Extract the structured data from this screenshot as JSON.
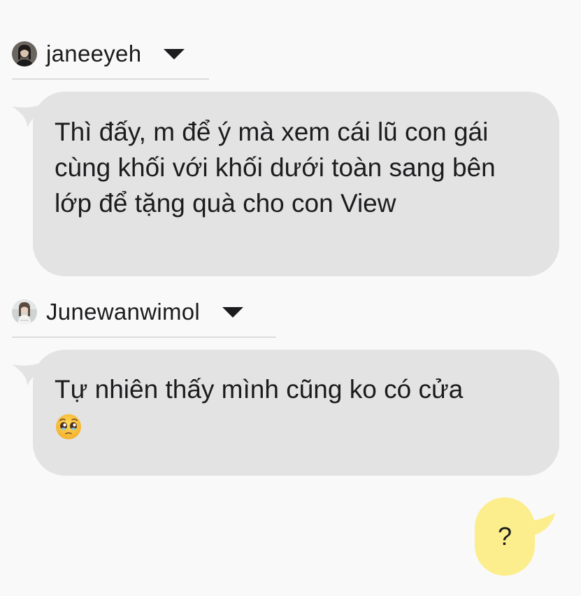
{
  "messages": [
    {
      "sender": "janeeyeh",
      "text": "Thì đấy, m để ý mà xem cái lũ con gái cùng khối với khối dưới toàn sang bên lớp để tặng quà cho con View"
    },
    {
      "sender": "Junewanwimol",
      "text": "Tự nhiên thấy mình cũng ko có cửa",
      "emoji": "pleading-face-emoji"
    }
  ],
  "my_message": {
    "text": "?"
  },
  "colors": {
    "background": "#f9f9f9",
    "incoming_bubble": "#e3e3e3",
    "outgoing_bubble": "#fcee8c",
    "divider": "#dcdcdc"
  },
  "icons": {
    "dropdown": "caret-down-icon",
    "avatar_1": "avatar-janeeyeh",
    "avatar_2": "avatar-junewanwimol"
  }
}
